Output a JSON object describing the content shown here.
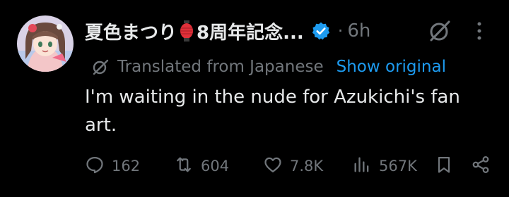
{
  "tweet": {
    "display_name": "夏色まつり",
    "display_name_rest": "8周年記念...",
    "dot": "·",
    "time": "6h",
    "translated_label": "Translated from Japanese",
    "show_original_label": "Show original",
    "text": "I'm waiting in the nude for Azukichi's fan art.",
    "actions": {
      "reply_count": "162",
      "repost_count": "604",
      "like_count": "7.8K",
      "views_count": "567K"
    }
  },
  "colors": {
    "background": "#000000",
    "text": "#e7e9ea",
    "muted": "#71767b",
    "link": "#1d9bf0",
    "verified": "#1d9bf0"
  },
  "icons": {
    "avatar": "user-avatar",
    "lantern": "red-lantern-emoji",
    "verified": "verified-badge-icon",
    "grok": "grok-icon",
    "more": "more-icon",
    "translate": "translate-icon",
    "reply": "reply-icon",
    "repost": "repost-icon",
    "like": "like-icon",
    "views": "views-icon",
    "bookmark": "bookmark-icon",
    "share": "share-icon"
  }
}
